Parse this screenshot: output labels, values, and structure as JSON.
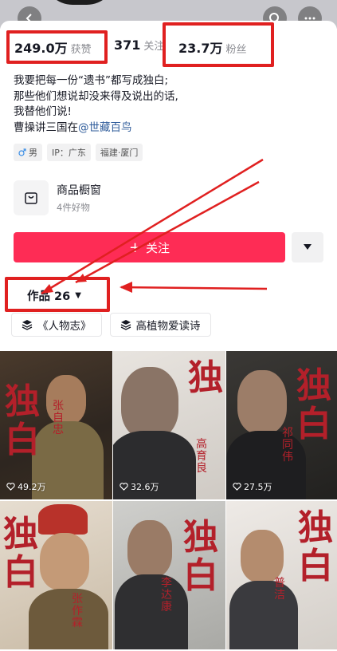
{
  "stats": {
    "likes_value": "249.0万",
    "likes_label": "获赞",
    "following_value": "371",
    "following_label": "关注",
    "fans_value": "23.7万",
    "fans_label": "粉丝"
  },
  "bio": {
    "line1": "我要把每一份“遗书”都写成独白;",
    "line2": "那些他们想说却没来得及说出的话,",
    "line3": "我替他们说!",
    "line4_prefix": "曹操讲三国在",
    "line4_mention": "@世藏百鸟"
  },
  "tags": {
    "gender": "男",
    "ip": "IP：广东",
    "location": "福建·厦门"
  },
  "shop": {
    "title": "商品橱窗",
    "subtitle": "4件好物"
  },
  "actions": {
    "follow_label": "关注",
    "follow_plus": "+"
  },
  "works_tab": {
    "label": "作品 26"
  },
  "collections": [
    {
      "label": "《人物志》"
    },
    {
      "label": "高植物爱读诗"
    }
  ],
  "videos": [
    {
      "likes": "49.2万",
      "big_text": "独白",
      "name": "张自忠"
    },
    {
      "likes": "32.6万",
      "big_text": "独",
      "name": "高育良"
    },
    {
      "likes": "27.5万",
      "big_text": "独白",
      "name": "祁同伟"
    },
    {
      "likes": "",
      "big_text": "独白",
      "name": "张作霖"
    },
    {
      "likes": "",
      "big_text": "独白",
      "name": "李达康"
    },
    {
      "likes": "",
      "big_text": "独白",
      "name": "普洁"
    }
  ],
  "colors": {
    "accent": "#fe2c55",
    "highlight": "#e02020",
    "mention": "#2e5b9a",
    "title_red": "#b3202a"
  }
}
